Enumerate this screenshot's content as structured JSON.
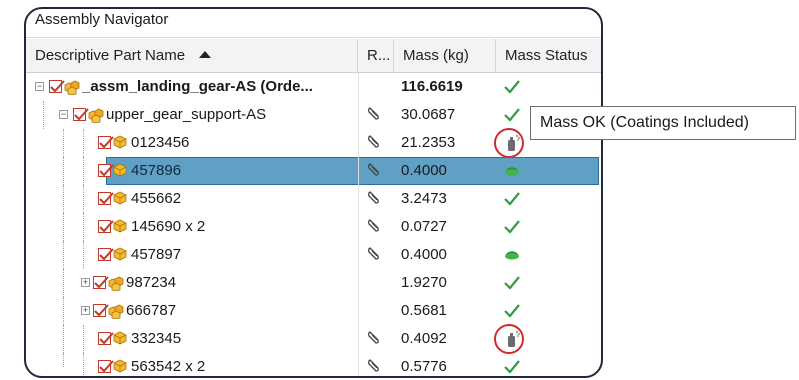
{
  "panel": {
    "title": "Assembly Navigator"
  },
  "columns": {
    "name": "Descriptive Part Name",
    "r": "R...",
    "mass": "Mass (kg)",
    "status": "Mass Status"
  },
  "rows": [
    {
      "name": "_assm_landing_gear-AS (Orde...",
      "mass": "116.6619",
      "status": "ok",
      "bold": true,
      "expander": "-",
      "icon": "assembly",
      "ref": false
    },
    {
      "name": "upper_gear_support-AS",
      "mass": "30.0687",
      "status": "ok",
      "expander": "-",
      "icon": "assembly",
      "ref": true
    },
    {
      "name": "0123456",
      "mass": "21.2353",
      "status": "coating",
      "icon": "part",
      "ref": true
    },
    {
      "name": "457896",
      "mass": "0.4000",
      "status": "estimated",
      "icon": "part",
      "ref": true,
      "selected": true
    },
    {
      "name": "455662",
      "mass": "3.2473",
      "status": "ok",
      "icon": "part",
      "ref": true
    },
    {
      "name": "145690 x 2",
      "mass": "0.0727",
      "status": "ok",
      "icon": "part",
      "ref": true
    },
    {
      "name": "457897",
      "mass": "0.4000",
      "status": "estimated",
      "icon": "part",
      "ref": true
    },
    {
      "name": "987234",
      "mass": "1.9270",
      "status": "ok",
      "expander": "+",
      "icon": "assembly",
      "ref": false
    },
    {
      "name": "666787",
      "mass": "0.5681",
      "status": "ok",
      "expander": "+",
      "icon": "assembly",
      "ref": false
    },
    {
      "name": "332345",
      "mass": "0.4092",
      "status": "coating",
      "icon": "part",
      "ref": true
    },
    {
      "name": "563542 x 2",
      "mass": "0.5776",
      "status": "ok",
      "icon": "part",
      "ref": true
    }
  ],
  "tooltip": {
    "text": "Mass OK (Coatings Included)"
  },
  "colors": {
    "selection": "#5fa0c4",
    "check": "#2e9d3a",
    "highlight_circle": "#d12a2a",
    "checkbox": "#c0392b"
  }
}
